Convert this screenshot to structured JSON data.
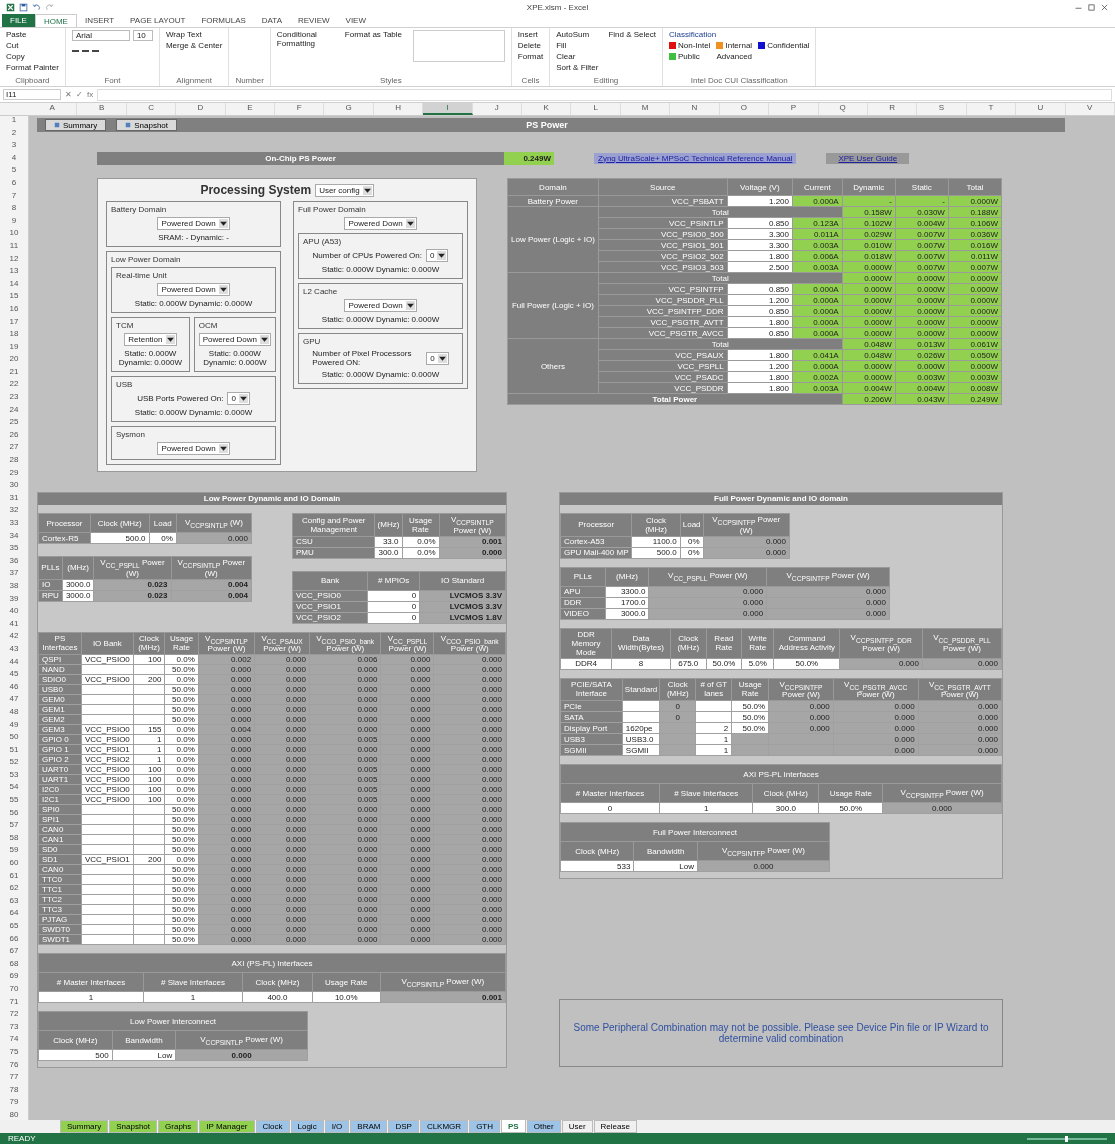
{
  "window": {
    "title": "XPE.xlsm - Excel"
  },
  "ribbon": {
    "tabs": [
      {
        "label": "FILE",
        "selected": false,
        "kind": "file"
      },
      {
        "label": "HOME",
        "selected": true,
        "kind": "tab"
      },
      {
        "label": "INSERT",
        "selected": false,
        "kind": "tab"
      },
      {
        "label": "PAGE LAYOUT",
        "selected": false,
        "kind": "tab"
      },
      {
        "label": "FORMULAS",
        "selected": false,
        "kind": "tab"
      },
      {
        "label": "DATA",
        "selected": false,
        "kind": "tab"
      },
      {
        "label": "REVIEW",
        "selected": false,
        "kind": "tab"
      },
      {
        "label": "VIEW",
        "selected": false,
        "kind": "tab"
      }
    ],
    "groups": [
      {
        "label": "Clipboard",
        "kind": "commands",
        "commands": [
          "Paste",
          "Cut",
          "Copy",
          "Format Painter"
        ]
      },
      {
        "label": "Font",
        "kind": "font",
        "commands": [
          "Arial",
          "10"
        ]
      },
      {
        "label": "Alignment",
        "kind": "commands",
        "commands": [
          "Wrap Text",
          "Merge & Center"
        ]
      },
      {
        "label": "Number",
        "kind": "commands"
      },
      {
        "label": "Styles",
        "kind": "styles",
        "commands": [
          "Conditional Formatting",
          "Format as Table"
        ]
      },
      {
        "label": "Cells",
        "kind": "commands",
        "commands": [
          "Insert",
          "Delete",
          "Format"
        ]
      },
      {
        "label": "Editing",
        "kind": "commands",
        "commands": [
          "AutoSum",
          "Fill",
          "Clear",
          "Sort & Filter",
          "Find & Select"
        ]
      },
      {
        "label": "Intel Doc CUI Classification",
        "kind": "classification",
        "title": "Classification",
        "options": [
          {
            "label": "Non-Intel",
            "color": "#e01010"
          },
          {
            "label": "Internal",
            "color": "#f09020"
          },
          {
            "label": "Confidential",
            "color": "#1010d0"
          },
          {
            "label": "Public",
            "color": "#40c040"
          }
        ],
        "commands": [
          "Advanced"
        ]
      }
    ]
  },
  "formula_bar": {
    "name_box": "I11",
    "buttons": [
      "✕",
      "✓",
      "fx"
    ]
  },
  "columns": [
    {
      "label": "A",
      "selected": false
    },
    {
      "label": "B",
      "selected": false
    },
    {
      "label": "C",
      "selected": false
    },
    {
      "label": "D",
      "selected": false
    },
    {
      "label": "E",
      "selected": false
    },
    {
      "label": "F",
      "selected": false
    },
    {
      "label": "G",
      "selected": false
    },
    {
      "label": "H",
      "selected": false
    },
    {
      "label": "I",
      "selected": true
    },
    {
      "label": "J",
      "selected": false
    },
    {
      "label": "K",
      "selected": false
    },
    {
      "label": "L",
      "selected": false
    },
    {
      "label": "M",
      "selected": false
    },
    {
      "label": "N",
      "selected": false
    },
    {
      "label": "O",
      "selected": false
    },
    {
      "label": "P",
      "selected": false
    },
    {
      "label": "Q",
      "selected": false
    },
    {
      "label": "R",
      "selected": false
    },
    {
      "label": "S",
      "selected": false
    },
    {
      "label": "T",
      "selected": false
    },
    {
      "label": "U",
      "selected": false
    },
    {
      "label": "V",
      "selected": false
    }
  ],
  "row_numbers": [
    "1",
    "2",
    "3",
    "4",
    "5",
    "6",
    "7",
    "8",
    "9",
    "10",
    "11",
    "12",
    "13",
    "14",
    "15",
    "16",
    "17",
    "18",
    "19",
    "20",
    "21",
    "22",
    "23",
    "24",
    "25",
    "26",
    "27",
    "28",
    "29",
    "30",
    "31",
    "32",
    "33",
    "34",
    "35",
    "36",
    "37",
    "38",
    "39",
    "40",
    "41",
    "42",
    "43",
    "44",
    "45",
    "46",
    "47",
    "48",
    "49",
    "50",
    "51",
    "52",
    "53",
    "54",
    "55",
    "56",
    "57",
    "58",
    "59",
    "60",
    "61",
    "62",
    "63",
    "64",
    "65",
    "66",
    "67",
    "68",
    "69",
    "70",
    "71",
    "72",
    "73",
    "74",
    "75",
    "76",
    "77",
    "78",
    "79",
    "80"
  ],
  "sheet_header": {
    "buttons": [
      "Summary",
      "Snapshot"
    ],
    "title": "PS Power"
  },
  "ps_power": {
    "title": "On-Chip PS Power",
    "value": "0.249W",
    "links": [
      "Zynq UltraScale+ MPSoC Technical Reference Manual",
      "XPE User Guide"
    ]
  },
  "processing_system": {
    "title": "Processing System",
    "mode": "User config",
    "left": [
      {
        "kind": "box",
        "title": "Battery Domain",
        "value": "Powered Down",
        "readout": "SRAM: -   Dynamic: -"
      },
      {
        "kind": "box",
        "title": "Low Power Domain",
        "children": [
          {
            "kind": "box",
            "title": "Real-time Unit",
            "value": "Powered Down",
            "readout": "Static: 0.000W   Dynamic: 0.000W"
          },
          {
            "kind": "pair",
            "children": [
              {
                "kind": "box",
                "title": "TCM",
                "value": "Retention",
                "readout": "Static: 0.000W  Dynamic: 0.000W"
              },
              {
                "kind": "box",
                "title": "OCM",
                "value": "Powered Down",
                "readout": "Static: 0.000W  Dynamic: 0.000W"
              }
            ]
          },
          {
            "kind": "box",
            "title": "USB",
            "label": "USB Ports Powered On:",
            "value": "0",
            "readout": "Static: 0.000W   Dynamic: 0.000W"
          },
          {
            "kind": "box",
            "title": "Sysmon",
            "value": "Powered Down"
          }
        ]
      }
    ],
    "right": [
      {
        "kind": "box",
        "title": "Full Power Domain",
        "value": "Powered Down",
        "children": [
          {
            "kind": "box",
            "title": "APU (A53)",
            "label": "Number of CPUs Powered On:",
            "value": "0",
            "readout": "Static: 0.000W   Dynamic: 0.000W"
          },
          {
            "kind": "box",
            "title": "L2 Cache",
            "value": "Powered Down",
            "readout": "Static: 0.000W   Dynamic: 0.000W"
          },
          {
            "kind": "box",
            "title": "GPU",
            "label": "Number of Pixel Processors Powered ON:",
            "value": "0",
            "readout": "Static: 0.000W   Dynamic: 0.000W"
          }
        ]
      }
    ]
  },
  "power_table": {
    "columns": [
      "Domain",
      "Source",
      "Voltage (V)",
      "Current",
      "Dynamic",
      "Static",
      "Total"
    ],
    "domains": [
      {
        "name": "Battery Power",
        "rows": [
          {
            "source": "VCC_PSBATT",
            "voltage": "1.200",
            "current": "0.000A",
            "dynamic": "-",
            "static": "-",
            "total": "0.000W"
          }
        ]
      },
      {
        "name": "Low Power (Logic + IO)",
        "total": {
          "label": "Total",
          "dynamic": "0.158W",
          "static": "0.030W",
          "total": "0.188W"
        },
        "rows": [
          {
            "source": "VCC_PSINTLP",
            "voltage": "0.850",
            "current": "0.123A",
            "dynamic": "0.102W",
            "static": "0.004W",
            "total": "0.106W"
          },
          {
            "source": "VCC_PSIO0_500",
            "voltage": "3.300",
            "current": "0.011A",
            "dynamic": "0.029W",
            "static": "0.007W",
            "total": "0.036W"
          },
          {
            "source": "VCC_PSIO1_501",
            "voltage": "3.300",
            "current": "0.003A",
            "dynamic": "0.010W",
            "static": "0.007W",
            "total": "0.016W"
          },
          {
            "source": "VCC_PSIO2_502",
            "voltage": "1.800",
            "current": "0.006A",
            "dynamic": "0.018W",
            "static": "0.007W",
            "total": "0.011W"
          },
          {
            "source": "VCC_PSIO3_503",
            "voltage": "2.500",
            "current": "0.003A",
            "dynamic": "0.000W",
            "static": "0.007W",
            "total": "0.007W"
          }
        ]
      },
      {
        "name": "Full Power (Logic + IO)",
        "total": {
          "label": "Total",
          "dynamic": "0.000W",
          "static": "0.000W",
          "total": "0.000W"
        },
        "rows": [
          {
            "source": "VCC_PSINTFP",
            "voltage": "0.850",
            "current": "0.000A",
            "dynamic": "0.000W",
            "static": "0.000W",
            "total": "0.000W"
          },
          {
            "source": "VCC_PSDDR_PLL",
            "voltage": "1.200",
            "current": "0.000A",
            "dynamic": "0.000W",
            "static": "0.000W",
            "total": "0.000W"
          },
          {
            "source": "VCC_PSINTFP_DDR",
            "voltage": "0.850",
            "current": "0.000A",
            "dynamic": "0.000W",
            "static": "0.000W",
            "total": "0.000W"
          },
          {
            "source": "VCC_PSGTR_AVTT",
            "voltage": "1.800",
            "current": "0.000A",
            "dynamic": "0.000W",
            "static": "0.000W",
            "total": "0.000W"
          },
          {
            "source": "VCC_PSGTR_AVCC",
            "voltage": "0.850",
            "current": "0.000A",
            "dynamic": "0.000W",
            "static": "0.000W",
            "total": "0.000W"
          }
        ]
      },
      {
        "name": "Others",
        "total": {
          "label": "Total",
          "dynamic": "0.048W",
          "static": "0.013W",
          "total": "0.061W"
        },
        "rows": [
          {
            "source": "VCC_PSAUX",
            "voltage": "1.800",
            "current": "0.041A",
            "dynamic": "0.048W",
            "static": "0.026W",
            "total": "0.050W"
          },
          {
            "source": "VCC_PSPLL",
            "voltage": "1.200",
            "current": "0.000A",
            "dynamic": "0.000W",
            "static": "0.000W",
            "total": "0.000W"
          },
          {
            "source": "VCC_PSADC",
            "voltage": "1.800",
            "current": "0.002A",
            "dynamic": "0.000W",
            "static": "0.003W",
            "total": "0.003W"
          },
          {
            "source": "VCC_PSDDR",
            "voltage": "1.800",
            "current": "0.003A",
            "dynamic": "0.004W",
            "static": "0.004W",
            "total": "0.008W"
          }
        ]
      }
    ],
    "total_power": {
      "label": "Total Power",
      "dynamic": "0.206W",
      "static": "0.043W",
      "total": "0.249W"
    }
  },
  "low_power": {
    "title": "Low Power Dynamic and IO Domain",
    "processor": {
      "columns": [
        "Processor",
        "Clock (MHz)",
        "Load",
        "V$_{CCPSINTLP}$ (W)"
      ],
      "rows": [
        [
          "Cortex-R5",
          "500.0",
          "0%",
          "0.000"
        ]
      ]
    },
    "config": {
      "columns": [
        "Config and Power Management",
        "(MHz)",
        "Usage Rate",
        "V$_{CCPSINTLP}$ Power (W)"
      ],
      "rows": [
        [
          "CSU",
          "33.0",
          "0.0%",
          "0.001"
        ],
        [
          "PMU",
          "300.0",
          "0.0%",
          "0.000"
        ]
      ]
    },
    "plls": {
      "columns": [
        "PLLs",
        "(MHz)",
        "V$_{CC_PSPLL}$ Power (W)",
        "V$_{CCPSINTLP}$ Power (W)"
      ],
      "rows": [
        [
          "IO",
          "3000.0",
          "0.023",
          "0.004"
        ],
        [
          "RPU",
          "3000.0",
          "0.023",
          "0.004"
        ]
      ]
    },
    "banks": {
      "columns": [
        "Bank",
        "# MPIOs",
        "IO Standard"
      ],
      "rows": [
        [
          "VCC_PSIO0",
          "0",
          "LVCMOS 3.3V"
        ],
        [
          "VCC_PSIO1",
          "0",
          "LVCMOS 3.3V"
        ],
        [
          "VCC_PSIO2",
          "0",
          "LVCMOS 1.8V"
        ]
      ]
    },
    "io": {
      "columns": [
        "PS Interfaces",
        "IO Bank",
        "Clock (MHz)",
        "Usage Rate",
        "V$_{CCPSINTLP}$ Power (W)",
        "V$_{CC_PSAUX}$ Power (W)",
        "V$_{CCO_PSIO_bank}$ Power (W)",
        "V$_{CC_PSPLL}$ Power (W)",
        "V$_{CCO_PSIO_bank}$ Power (W)"
      ],
      "rows": [
        {
          "name": "QSPI",
          "bank": "VCC_PSIO0",
          "clock": "100",
          "usage": "0.0%",
          "power": [
            "0.002",
            "0.000",
            "0.006",
            "0.000",
            "0.000"
          ]
        },
        {
          "name": "NAND",
          "usage": "50.0%",
          "power": [
            "0.000",
            "0.000",
            "0.000",
            "0.000",
            "0.000"
          ]
        },
        {
          "name": "SDIO0",
          "bank": "VCC_PSIO0",
          "clock": "200",
          "usage": "0.0%",
          "power": [
            "0.000",
            "0.000",
            "0.000",
            "0.000",
            "0.000"
          ]
        },
        {
          "name": "USB0",
          "usage": "50.0%",
          "power": [
            "0.000",
            "0.000",
            "0.000",
            "0.000",
            "0.000"
          ]
        },
        {
          "name": "GEM0",
          "usage": "50.0%",
          "power": [
            "0.000",
            "0.000",
            "0.000",
            "0.000",
            "0.000"
          ]
        },
        {
          "name": "GEM1",
          "usage": "50.0%",
          "power": [
            "0.000",
            "0.000",
            "0.000",
            "0.000",
            "0.000"
          ]
        },
        {
          "name": "GEM2",
          "usage": "50.0%",
          "power": [
            "0.000",
            "0.000",
            "0.000",
            "0.000",
            "0.000"
          ]
        },
        {
          "name": "GEM3",
          "bank": "VCC_PSIO0",
          "clock": "155",
          "usage": "0.0%",
          "power": [
            "0.004",
            "0.000",
            "0.000",
            "0.000",
            "0.000"
          ]
        },
        {
          "name": "GPIO 0",
          "bank": "VCC_PSIO0",
          "clock": "1",
          "usage": "0.0%",
          "power": [
            "0.000",
            "0.000",
            "0.005",
            "0.000",
            "0.000"
          ]
        },
        {
          "name": "GPIO 1",
          "bank": "VCC_PSIO1",
          "clock": "1",
          "usage": "0.0%",
          "power": [
            "0.000",
            "0.000",
            "0.000",
            "0.000",
            "0.000"
          ]
        },
        {
          "name": "GPIO 2",
          "bank": "VCC_PSIO2",
          "clock": "1",
          "usage": "0.0%",
          "power": [
            "0.000",
            "0.000",
            "0.000",
            "0.000",
            "0.000"
          ]
        },
        {
          "name": "UART0",
          "bank": "VCC_PSIO0",
          "clock": "100",
          "usage": "0.0%",
          "power": [
            "0.000",
            "0.000",
            "0.005",
            "0.000",
            "0.000"
          ]
        },
        {
          "name": "UART1",
          "bank": "VCC_PSIO0",
          "clock": "100",
          "usage": "0.0%",
          "power": [
            "0.000",
            "0.000",
            "0.005",
            "0.000",
            "0.000"
          ]
        },
        {
          "name": "I2C0",
          "bank": "VCC_PSIO0",
          "clock": "100",
          "usage": "0.0%",
          "power": [
            "0.000",
            "0.000",
            "0.005",
            "0.000",
            "0.000"
          ]
        },
        {
          "name": "I2C1",
          "bank": "VCC_PSIO0",
          "clock": "100",
          "usage": "0.0%",
          "power": [
            "0.000",
            "0.000",
            "0.005",
            "0.000",
            "0.000"
          ]
        },
        {
          "name": "SPI0",
          "usage": "50.0%",
          "power": [
            "0.000",
            "0.000",
            "0.000",
            "0.000",
            "0.000"
          ]
        },
        {
          "name": "SPI1",
          "usage": "50.0%",
          "power": [
            "0.000",
            "0.000",
            "0.000",
            "0.000",
            "0.000"
          ]
        },
        {
          "name": "CAN0",
          "usage": "50.0%",
          "power": [
            "0.000",
            "0.000",
            "0.000",
            "0.000",
            "0.000"
          ]
        },
        {
          "name": "CAN1",
          "usage": "50.0%",
          "power": [
            "0.000",
            "0.000",
            "0.000",
            "0.000",
            "0.000"
          ]
        },
        {
          "name": "SD0",
          "usage": "50.0%",
          "power": [
            "0.000",
            "0.000",
            "0.000",
            "0.000",
            "0.000"
          ]
        },
        {
          "name": "SD1",
          "bank": "VCC_PSIO1",
          "clock": "200",
          "usage": "0.0%",
          "power": [
            "0.000",
            "0.000",
            "0.000",
            "0.000",
            "0.000"
          ]
        },
        {
          "name": "CAN0",
          "usage": "50.0%",
          "power": [
            "0.000",
            "0.000",
            "0.000",
            "0.000",
            "0.000"
          ]
        },
        {
          "name": "TTC0",
          "usage": "50.0%",
          "power": [
            "0.000",
            "0.000",
            "0.000",
            "0.000",
            "0.000"
          ]
        },
        {
          "name": "TTC1",
          "usage": "50.0%",
          "power": [
            "0.000",
            "0.000",
            "0.000",
            "0.000",
            "0.000"
          ]
        },
        {
          "name": "TTC2",
          "usage": "50.0%",
          "power": [
            "0.000",
            "0.000",
            "0.000",
            "0.000",
            "0.000"
          ]
        },
        {
          "name": "TTC3",
          "usage": "50.0%",
          "power": [
            "0.000",
            "0.000",
            "0.000",
            "0.000",
            "0.000"
          ]
        },
        {
          "name": "PJTAG",
          "usage": "50.0%",
          "power": [
            "0.000",
            "0.000",
            "0.000",
            "0.000",
            "0.000"
          ]
        },
        {
          "name": "SWDT0",
          "usage": "50.0%",
          "power": [
            "0.000",
            "0.000",
            "0.000",
            "0.000",
            "0.000"
          ]
        },
        {
          "name": "SWDT1",
          "usage": "50.0%",
          "power": [
            "0.000",
            "0.000",
            "0.000",
            "0.000",
            "0.000"
          ]
        }
      ]
    },
    "axi": {
      "title": "AXI (PS-PL) Interfaces",
      "columns": [
        "# Master Interfaces",
        "# Slave Interfaces",
        "Clock (MHz)",
        "Usage Rate",
        "V$_{CCPSINTLP}$ Power (W)"
      ],
      "row": [
        "1",
        "1",
        "400.0",
        "10.0%",
        "0.001"
      ]
    },
    "interconnect": {
      "title": "Low Power Interconnect",
      "columns": [
        "Clock (MHz)",
        "Bandwidth",
        "V$_{CCPSINTLP}$ Power (W)"
      ],
      "row": [
        "500",
        "Low",
        "0.000"
      ]
    }
  },
  "full_power": {
    "title": "Full Power Dynamic and IO domain",
    "processor": {
      "columns": [
        "Processor",
        "Clock (MHz)",
        "Load",
        "V$_{CCPSINTFP}$ Power (W)"
      ],
      "rows": [
        [
          "Cortex-A53",
          "1100.0",
          "0%",
          "0.000"
        ],
        [
          "GPU Mali-400 MP",
          "500.0",
          "0%",
          "0.000"
        ]
      ]
    },
    "plls": {
      "columns": [
        "PLLs",
        "(MHz)",
        "V$_{CC_PSPLL}$ Power (W)",
        "V$_{CCPSINTFP}$ Power (W)"
      ],
      "rows": [
        [
          "APU",
          "3300.0",
          "0.000",
          "0.000"
        ],
        [
          "DDR",
          "1700.0",
          "0.000",
          "0.000"
        ],
        [
          "VIDEO",
          "3000.0",
          "0.000",
          "0.000"
        ]
      ]
    },
    "ddr": {
      "columns": [
        "DDR Memory Mode",
        "Data Width(Bytes)",
        "Clock (MHz)",
        "Read Rate",
        "Write Rate",
        "Command Address Activity",
        "V$_{CCPSINTFP_DDR}$ Power (W)",
        "V$_{CC_PSDDR_PLL}$ Power (W)"
      ],
      "row": [
        "DDR4",
        "8",
        "675.0",
        "50.0%",
        "5.0%",
        "50.0%",
        "0.000",
        "0.000"
      ]
    },
    "gtr": {
      "columns": [
        "PCIE/SATA Interface",
        "Standard",
        "Clock (MHz)",
        "# of GT lanes",
        "Usage Rate",
        "V$_{CCPSINTFP}$ Power (W)",
        "V$_{CC_PSGTR_AVCC}$ Power (W)",
        "V$_{CC_PSGTR_AVTT}$ Power (W)"
      ],
      "rows": [
        {
          "name": "PCIe",
          "clock": "0",
          "usage": "50.0%",
          "power": [
            "0.000",
            "0.000",
            "0.000"
          ]
        },
        {
          "name": "SATA",
          "clock": "0",
          "usage": "50.0%",
          "power": [
            "0.000",
            "0.000",
            "0.000"
          ]
        },
        {
          "name": "Display Port",
          "standard": "1620pe",
          "lanes": "2",
          "usage": "50.0%",
          "power": [
            "0.000",
            "0.000",
            "0.000"
          ]
        },
        {
          "name": "USB3",
          "standard": "USB3.0",
          "lanes": "1",
          "power": [
            "0.000",
            "0.000"
          ]
        },
        {
          "name": "SGMII",
          "standard": "SGMII",
          "lanes": "1",
          "power": [
            "0.000",
            "0.000"
          ]
        }
      ]
    },
    "axi": {
      "title": "AXI PS-PL Interfaces",
      "columns": [
        "# Master Interfaces",
        "# Slave Interfaces",
        "Clock (MHz)",
        "Usage Rate",
        "V$_{CCPSINTFP}$ Power (W)"
      ],
      "row": [
        "0",
        "1",
        "300.0",
        "50.0%",
        "0.000"
      ]
    },
    "interconnect": {
      "title": "Full Power Interconnect",
      "columns": [
        "Clock (MHz)",
        "Bandwidth",
        "V$_{CCPSINTFP}$ Power (W)"
      ],
      "row": [
        "533",
        "Low",
        "0.000"
      ]
    }
  },
  "note": "Some Peripheral Combination may not be possible. Please see Device Pin file or IP Wizard to determine valid combination",
  "sheet_tabs": [
    {
      "label": "Summary",
      "selected": false,
      "color": "#92d050"
    },
    {
      "label": "Snapshot",
      "selected": false,
      "color": "#92d050"
    },
    {
      "label": "Graphs",
      "selected": false,
      "color": "#92d050"
    },
    {
      "label": "IP Manager",
      "selected": false,
      "color": "#92d050"
    },
    {
      "label": "Clock",
      "selected": false,
      "color": "#9dc3e6"
    },
    {
      "label": "Logic",
      "selected": false,
      "color": "#9dc3e6"
    },
    {
      "label": "I/O",
      "selected": false,
      "color": "#9dc3e6"
    },
    {
      "label": "BRAM",
      "selected": false,
      "color": "#9dc3e6"
    },
    {
      "label": "DSP",
      "selected": false,
      "color": "#9dc3e6"
    },
    {
      "label": "CLKMGR",
      "selected": false,
      "color": "#9dc3e6"
    },
    {
      "label": "GTH",
      "selected": false,
      "color": "#9dc3e6"
    },
    {
      "label": "PS",
      "selected": true,
      "color": "#ffffff"
    },
    {
      "label": "Other",
      "selected": false,
      "color": "#9dc3e6"
    },
    {
      "label": "User",
      "selected": false,
      "color": "#f0f0f0"
    },
    {
      "label": "Release",
      "selected": false,
      "color": "#f0f0f0"
    }
  ],
  "status_bar": {
    "text": "READY"
  }
}
